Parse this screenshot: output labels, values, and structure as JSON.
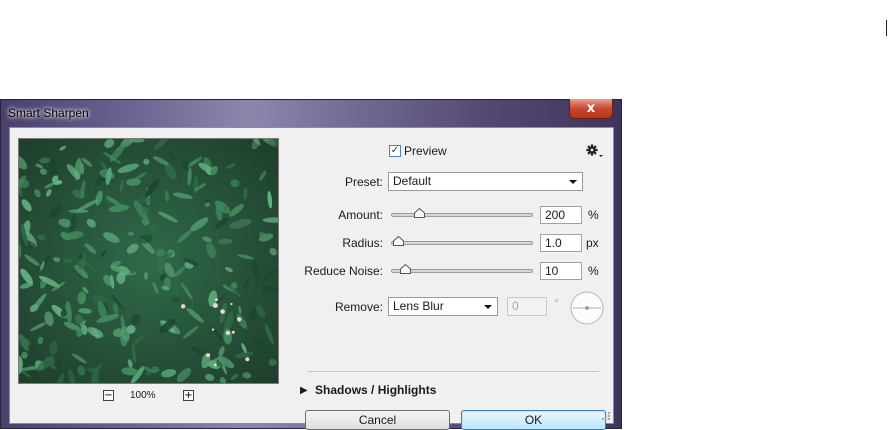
{
  "window": {
    "title": "Smart Sharpen",
    "close_glyph": "x"
  },
  "preview": {
    "checkbox_label": "Preview",
    "checked": true,
    "check_glyph": "✓",
    "zoom_out_glyph": "−",
    "zoom_in_glyph": "+",
    "zoom_level": "100%"
  },
  "icons": {
    "settings": "gear-icon",
    "angle": "angle-dial-icon"
  },
  "preset": {
    "label": "Preset:",
    "value": "Default"
  },
  "amount": {
    "label": "Amount:",
    "value": "200",
    "unit": "%",
    "fraction": 0.2
  },
  "radius": {
    "label": "Radius:",
    "value": "1.0",
    "unit": "px",
    "fraction": 0.05
  },
  "reduce_noise": {
    "label": "Reduce Noise:",
    "value": "10",
    "unit": "%",
    "fraction": 0.1
  },
  "remove": {
    "label": "Remove:",
    "value": "Lens Blur",
    "angle_value": "0",
    "angle_unit": "°"
  },
  "shadows_highlights": {
    "arrow_glyph": "▶",
    "label": "Shadows / Highlights"
  },
  "buttons": {
    "cancel": "Cancel",
    "ok": "OK"
  },
  "colors": {
    "frame": "#6b6190",
    "close": "#c9462f",
    "client": "#f0f0f0",
    "ok_border": "#3c7fb1"
  }
}
